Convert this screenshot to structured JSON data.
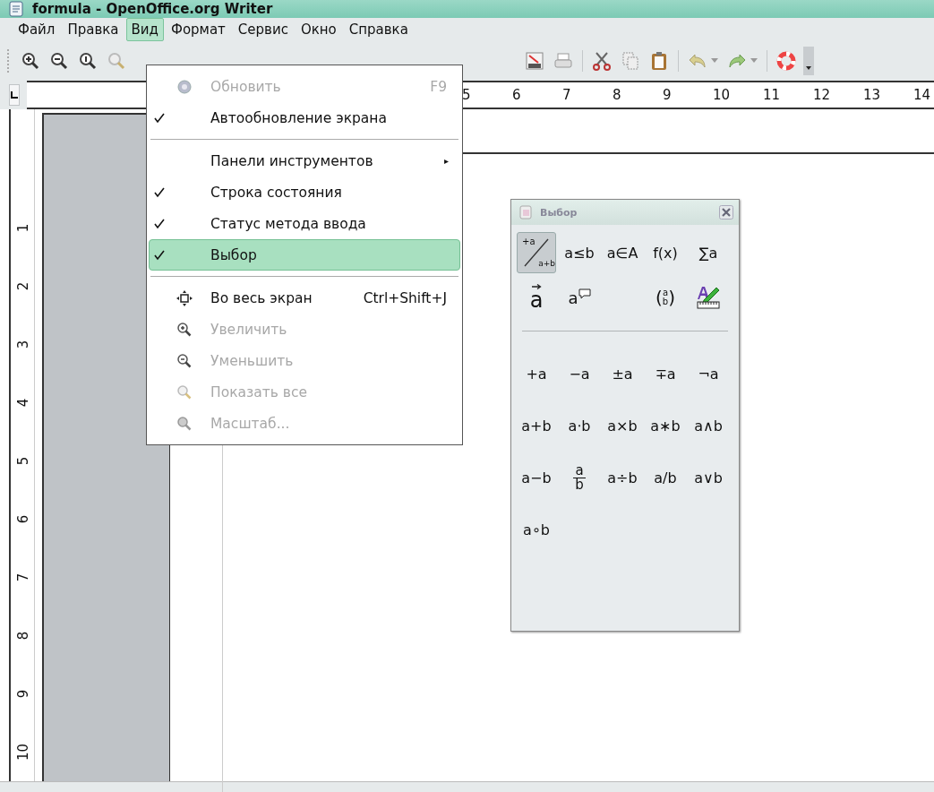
{
  "window": {
    "title": "formula - OpenOffice.org Writer"
  },
  "menu_bar": [
    {
      "label": "Файл",
      "selected": false
    },
    {
      "label": "Правка",
      "selected": false
    },
    {
      "label": "Вид",
      "selected": true
    },
    {
      "label": "Формат",
      "selected": false
    },
    {
      "label": "Сервис",
      "selected": false
    },
    {
      "label": "Окно",
      "selected": false
    },
    {
      "label": "Справка",
      "selected": false
    }
  ],
  "view_menu": [
    {
      "kind": "item",
      "label": "Обновить",
      "shortcut": "F9",
      "checked": false,
      "disabled": true,
      "selected": false
    },
    {
      "kind": "item",
      "label": "Автообновление экрана",
      "checked": true,
      "disabled": false,
      "selected": false
    },
    {
      "kind": "separator"
    },
    {
      "kind": "submenu",
      "label": "Панели инструментов",
      "arrow": "▸",
      "checked": false,
      "disabled": false,
      "selected": false
    },
    {
      "kind": "item",
      "label": "Строка состояния",
      "checked": true,
      "disabled": false,
      "selected": false
    },
    {
      "kind": "item",
      "label": "Статус метода ввода",
      "checked": true,
      "disabled": false,
      "selected": false
    },
    {
      "kind": "item",
      "label": "Выбор",
      "checked": true,
      "disabled": false,
      "selected": true
    },
    {
      "kind": "separator"
    },
    {
      "kind": "item",
      "label": "Во весь экран",
      "shortcut": "Ctrl+Shift+J",
      "checked": false,
      "disabled": false,
      "selected": false
    },
    {
      "kind": "item",
      "label": "Увеличить",
      "checked": false,
      "disabled": true,
      "selected": false
    },
    {
      "kind": "item",
      "label": "Уменьшить",
      "checked": false,
      "disabled": true,
      "selected": false
    },
    {
      "kind": "item",
      "label": "Показать все",
      "checked": false,
      "disabled": true,
      "selected": false
    },
    {
      "kind": "item",
      "label": "Масштаб...",
      "checked": false,
      "disabled": true,
      "selected": false
    }
  ],
  "ruler": {
    "numbers": [
      "5",
      "6",
      "7",
      "8",
      "9",
      "10",
      "11",
      "12",
      "13",
      "14"
    ]
  },
  "vertical_ruler": {
    "numbers": [
      "1",
      "2",
      "3",
      "4",
      "5",
      "6",
      "7",
      "8",
      "9",
      "10"
    ]
  },
  "elements_panel": {
    "title": "Выбор",
    "categories": [
      {
        "kind": "fraction",
        "top": "+a",
        "bottom": "a+b",
        "selected": true
      },
      {
        "kind": "text",
        "label": "a≤b",
        "selected": false
      },
      {
        "kind": "text",
        "label": "a∈A",
        "selected": false
      },
      {
        "kind": "text",
        "label": "f(x)",
        "selected": false
      },
      {
        "kind": "text",
        "label": "∑a",
        "selected": false
      },
      {
        "kind": "vector",
        "label": "a",
        "selected": false
      },
      {
        "kind": "attribute",
        "label": "a",
        "selected": false
      },
      {
        "kind": "gap"
      },
      {
        "kind": "paren",
        "left": "(",
        "top": "a",
        "bottom": "b",
        "right": ")",
        "selected": false
      },
      {
        "kind": "format",
        "selected": false
      }
    ],
    "symbols": [
      {
        "kind": "text",
        "label": "+a"
      },
      {
        "kind": "text",
        "label": "−a"
      },
      {
        "kind": "text",
        "label": "±a"
      },
      {
        "kind": "text",
        "label": "∓a"
      },
      {
        "kind": "text",
        "label": "¬a"
      },
      {
        "kind": "text",
        "label": "a+b"
      },
      {
        "kind": "text",
        "label": "a⋅b"
      },
      {
        "kind": "text",
        "label": "a×b"
      },
      {
        "kind": "text",
        "label": "a∗b"
      },
      {
        "kind": "text",
        "label": "a∧b"
      },
      {
        "kind": "text",
        "label": "a−b"
      },
      {
        "kind": "fraction",
        "top": "a",
        "bottom": "b"
      },
      {
        "kind": "text",
        "label": "a÷b"
      },
      {
        "kind": "text",
        "label": "a/b"
      },
      {
        "kind": "text",
        "label": "a∨b"
      },
      {
        "kind": "text",
        "label": "a∘b"
      }
    ]
  }
}
